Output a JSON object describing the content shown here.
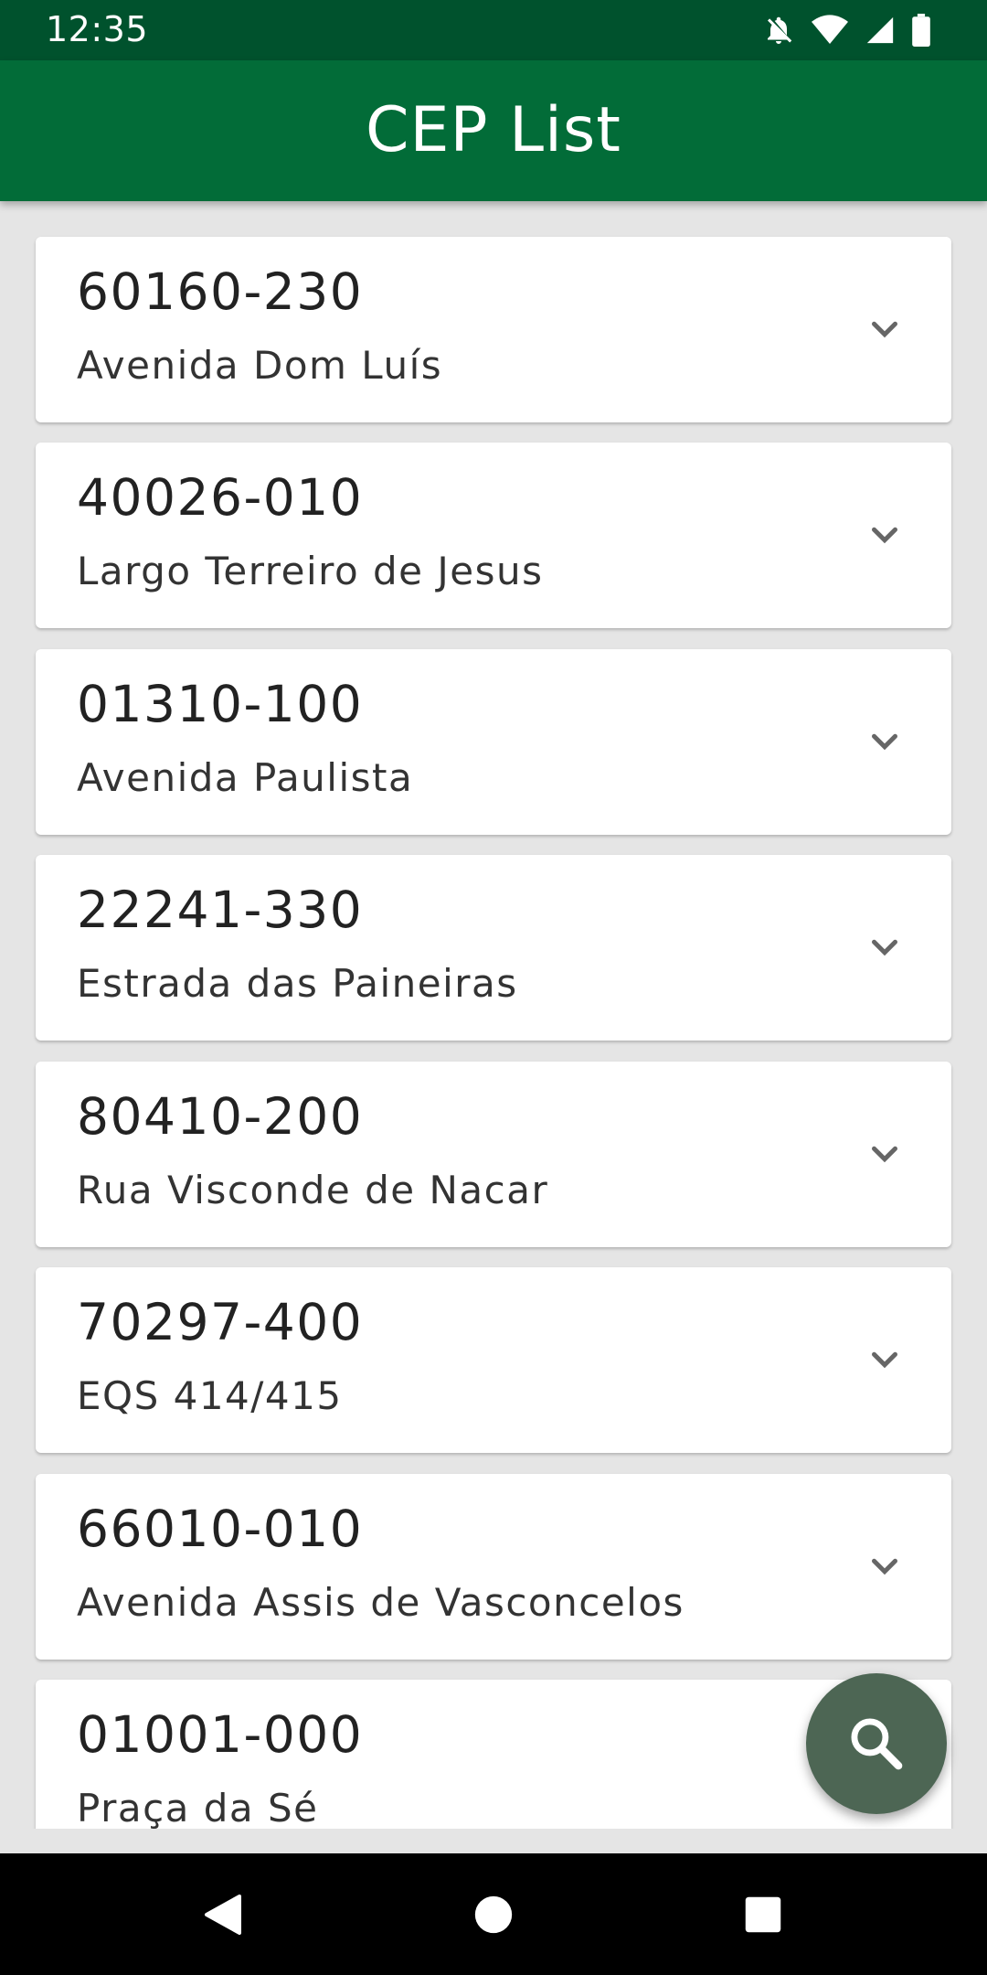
{
  "status_bar": {
    "time": "12:35",
    "icons": [
      "notifications-off-icon",
      "wifi-icon",
      "signal-icon",
      "battery-icon"
    ]
  },
  "app_bar": {
    "title": "CEP List",
    "color": "#026c38"
  },
  "items": [
    {
      "cep": "60160-230",
      "street": "Avenida Dom Luís"
    },
    {
      "cep": "40026-010",
      "street": "Largo Terreiro de Jesus"
    },
    {
      "cep": "01310-100",
      "street": "Avenida Paulista"
    },
    {
      "cep": "22241-330",
      "street": "Estrada das Paineiras"
    },
    {
      "cep": "80410-200",
      "street": "Rua Visconde de Nacar"
    },
    {
      "cep": "70297-400",
      "street": "EQS 414/415"
    },
    {
      "cep": "66010-010",
      "street": "Avenida Assis de Vasconcelos"
    },
    {
      "cep": "01001-000",
      "street": "Praça da Sé"
    }
  ],
  "fab": {
    "icon": "search-icon",
    "color": "#4d6654"
  },
  "nav_bar": {
    "icons": [
      "back-icon",
      "home-icon",
      "recents-icon"
    ]
  }
}
